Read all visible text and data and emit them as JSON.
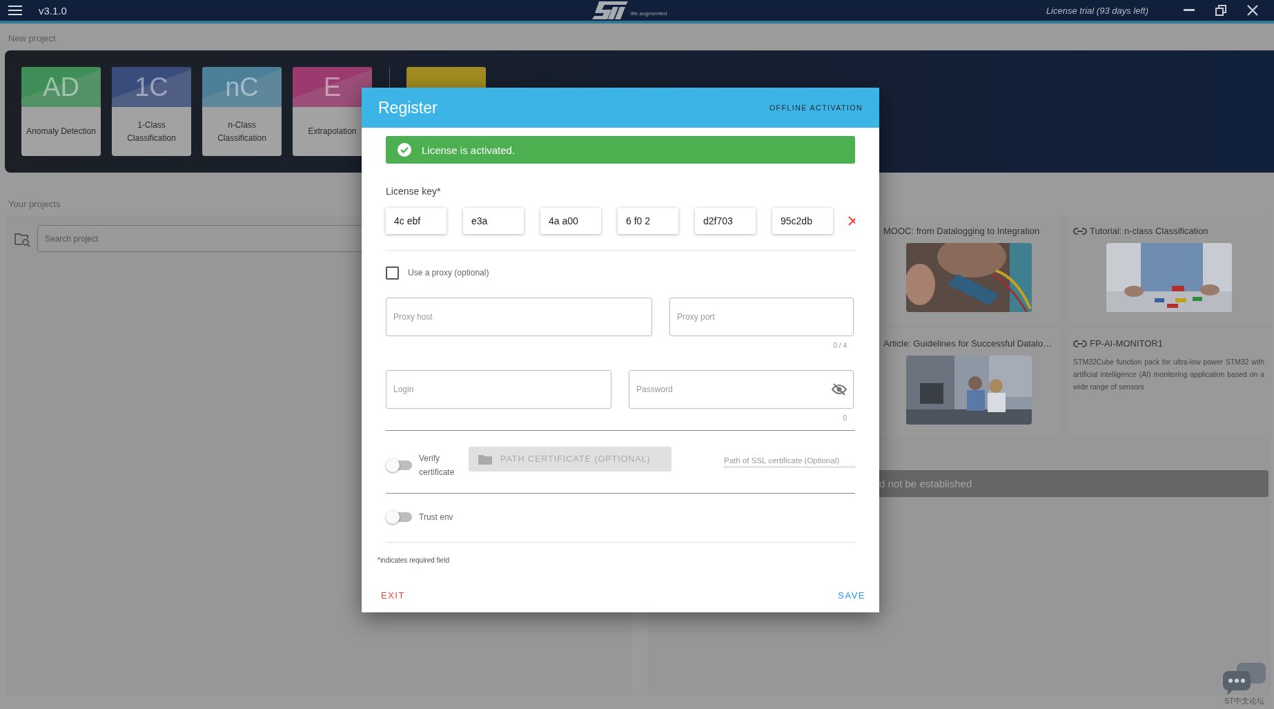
{
  "top_bar": {
    "version": "v3.1.0",
    "logo_tagline": "life.augmented",
    "license_status": "License trial (93 days left)"
  },
  "new_project": {
    "heading": "New project",
    "tiles": [
      {
        "abbr": "AD",
        "label": "Anomaly Detection",
        "color": "#3f8e57"
      },
      {
        "abbr": "1C",
        "label": "1-Class Classification",
        "color": "#3a4c7c"
      },
      {
        "abbr": "nC",
        "label": "n-Class Classification",
        "color": "#4c8099"
      },
      {
        "abbr": "E",
        "label": "Extrapolation",
        "color": "#9a3a6e"
      },
      {
        "color": "#a38d22"
      }
    ]
  },
  "your_projects": {
    "heading": "Your projects",
    "search": {
      "placeholder": "Search project"
    }
  },
  "resources": {
    "cards": [
      {
        "kind": "picture",
        "title": "MOOC: from Datalogging to Integration"
      },
      {
        "kind": "picture",
        "title": "Tutorial: n-class Classification"
      },
      {
        "kind": "picture",
        "title": "Article: Guidelines for Successful Datalo…"
      },
      {
        "kind": "text",
        "title": "FP-AI-MONITOR1",
        "description": "STM32Cube function pack for ultra-low power STM32 with artificial intelligence (AI) monitoring application based on a wide range of sensors"
      }
    ],
    "error": "d not be established"
  },
  "dialog": {
    "title": "Register",
    "offline_button": "OFFLINE ACTIVATION",
    "banner": "License is activated.",
    "license_key": {
      "label": "License key*",
      "parts": [
        "4c ebf",
        "e3a",
        "4a a00",
        "6 f0 2",
        "d2f703",
        "95c2db"
      ]
    },
    "proxy": {
      "label": "Use a proxy (optional)",
      "checked": false
    },
    "proxy_host": {
      "placeholder": "Proxy host"
    },
    "proxy_port": {
      "placeholder": "Proxy port",
      "counter": "0 / 4"
    },
    "login": {
      "placeholder": "Login"
    },
    "password": {
      "placeholder": "Password",
      "counter": "0"
    },
    "verify": {
      "label": "Verify certificate",
      "on": false
    },
    "path_button": {
      "label": "PATH CERTIFICATE (OPTIONAL)",
      "disabled": true
    },
    "path_field": {
      "placeholder": "Path of SSL certificate (Optional)"
    },
    "trust": {
      "label": "Trust env",
      "on": false
    },
    "required_note": "*indicates required field",
    "exit": "EXIT",
    "save": "SAVE"
  },
  "forum": {
    "label": "ST中文论坛"
  }
}
